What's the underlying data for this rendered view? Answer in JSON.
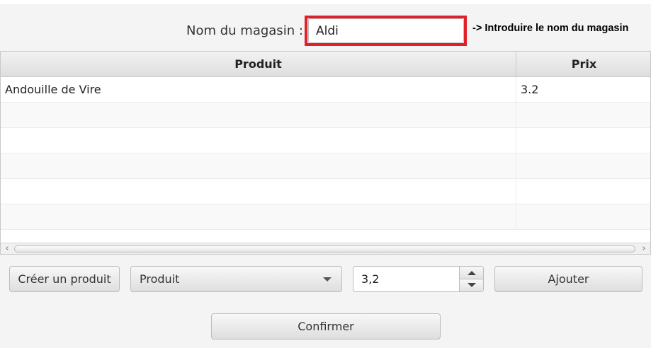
{
  "store": {
    "label": "Nom du magasin :",
    "value": "Aldi",
    "highlight_color": "#e0202b",
    "annotation": "-> Introduire le nom du magasin"
  },
  "table": {
    "columns": [
      "Produit",
      "Prix"
    ],
    "rows": [
      {
        "produit": "Andouille de Vire",
        "prix": "3.2"
      },
      {
        "produit": "",
        "prix": ""
      },
      {
        "produit": "",
        "prix": ""
      },
      {
        "produit": "",
        "prix": ""
      },
      {
        "produit": "",
        "prix": ""
      },
      {
        "produit": "",
        "prix": ""
      }
    ],
    "scroll_left_icon": "chevron-left-icon",
    "scroll_right_icon": "chevron-right-icon"
  },
  "controls": {
    "create_label": "Créer un produit",
    "combo_selected": "Produit",
    "combo_icon": "chevron-down-icon",
    "spinner_value": "3,2",
    "add_label": "Ajouter",
    "confirm_label": "Confirmer"
  }
}
